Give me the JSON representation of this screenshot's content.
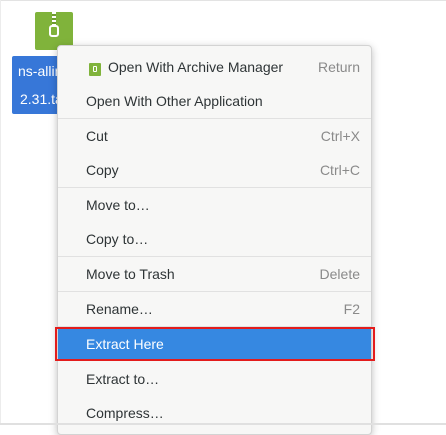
{
  "desktop": {
    "file": {
      "icon": "archive-icon",
      "name_line1": "ns-allin",
      "name_line2": "2.31.ta"
    }
  },
  "context_menu": {
    "items": [
      {
        "label": "Open With Archive Manager",
        "accel": "Return",
        "icon": "archive-manager-icon"
      },
      {
        "label": "Open With Other Application",
        "accel": ""
      },
      {
        "label": "Cut",
        "accel": "Ctrl+X"
      },
      {
        "label": "Copy",
        "accel": "Ctrl+C"
      },
      {
        "label": "Move to…",
        "accel": ""
      },
      {
        "label": "Copy to…",
        "accel": ""
      },
      {
        "label": "Move to Trash",
        "accel": "Delete"
      },
      {
        "label": "Rename…",
        "accel": "F2"
      },
      {
        "label": "Extract Here",
        "accel": "",
        "highlighted": true
      },
      {
        "label": "Extract to…",
        "accel": ""
      },
      {
        "label": "Compress…",
        "accel": ""
      }
    ]
  },
  "colors": {
    "highlight": "#3688e1",
    "annotation_outline": "#e31c1c",
    "archive_green": "#80b33b",
    "selection_blue": "#3777d8"
  }
}
